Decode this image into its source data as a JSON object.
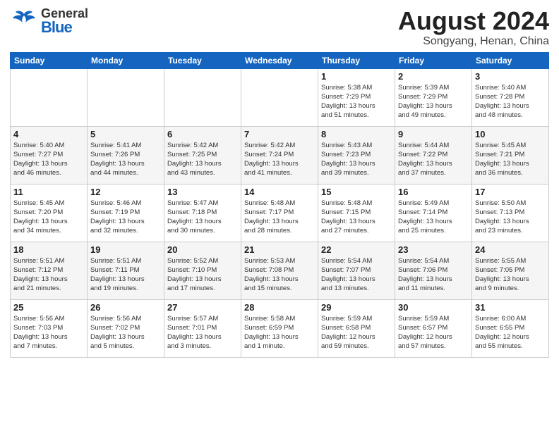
{
  "logo": {
    "general": "General",
    "blue": "Blue"
  },
  "title": "August 2024",
  "location": "Songyang, Henan, China",
  "days_of_week": [
    "Sunday",
    "Monday",
    "Tuesday",
    "Wednesday",
    "Thursday",
    "Friday",
    "Saturday"
  ],
  "weeks": [
    [
      {
        "day": "",
        "info": ""
      },
      {
        "day": "",
        "info": ""
      },
      {
        "day": "",
        "info": ""
      },
      {
        "day": "",
        "info": ""
      },
      {
        "day": "1",
        "info": "Sunrise: 5:38 AM\nSunset: 7:29 PM\nDaylight: 13 hours\nand 51 minutes."
      },
      {
        "day": "2",
        "info": "Sunrise: 5:39 AM\nSunset: 7:29 PM\nDaylight: 13 hours\nand 49 minutes."
      },
      {
        "day": "3",
        "info": "Sunrise: 5:40 AM\nSunset: 7:28 PM\nDaylight: 13 hours\nand 48 minutes."
      }
    ],
    [
      {
        "day": "4",
        "info": "Sunrise: 5:40 AM\nSunset: 7:27 PM\nDaylight: 13 hours\nand 46 minutes."
      },
      {
        "day": "5",
        "info": "Sunrise: 5:41 AM\nSunset: 7:26 PM\nDaylight: 13 hours\nand 44 minutes."
      },
      {
        "day": "6",
        "info": "Sunrise: 5:42 AM\nSunset: 7:25 PM\nDaylight: 13 hours\nand 43 minutes."
      },
      {
        "day": "7",
        "info": "Sunrise: 5:42 AM\nSunset: 7:24 PM\nDaylight: 13 hours\nand 41 minutes."
      },
      {
        "day": "8",
        "info": "Sunrise: 5:43 AM\nSunset: 7:23 PM\nDaylight: 13 hours\nand 39 minutes."
      },
      {
        "day": "9",
        "info": "Sunrise: 5:44 AM\nSunset: 7:22 PM\nDaylight: 13 hours\nand 37 minutes."
      },
      {
        "day": "10",
        "info": "Sunrise: 5:45 AM\nSunset: 7:21 PM\nDaylight: 13 hours\nand 36 minutes."
      }
    ],
    [
      {
        "day": "11",
        "info": "Sunrise: 5:45 AM\nSunset: 7:20 PM\nDaylight: 13 hours\nand 34 minutes."
      },
      {
        "day": "12",
        "info": "Sunrise: 5:46 AM\nSunset: 7:19 PM\nDaylight: 13 hours\nand 32 minutes."
      },
      {
        "day": "13",
        "info": "Sunrise: 5:47 AM\nSunset: 7:18 PM\nDaylight: 13 hours\nand 30 minutes."
      },
      {
        "day": "14",
        "info": "Sunrise: 5:48 AM\nSunset: 7:17 PM\nDaylight: 13 hours\nand 28 minutes."
      },
      {
        "day": "15",
        "info": "Sunrise: 5:48 AM\nSunset: 7:15 PM\nDaylight: 13 hours\nand 27 minutes."
      },
      {
        "day": "16",
        "info": "Sunrise: 5:49 AM\nSunset: 7:14 PM\nDaylight: 13 hours\nand 25 minutes."
      },
      {
        "day": "17",
        "info": "Sunrise: 5:50 AM\nSunset: 7:13 PM\nDaylight: 13 hours\nand 23 minutes."
      }
    ],
    [
      {
        "day": "18",
        "info": "Sunrise: 5:51 AM\nSunset: 7:12 PM\nDaylight: 13 hours\nand 21 minutes."
      },
      {
        "day": "19",
        "info": "Sunrise: 5:51 AM\nSunset: 7:11 PM\nDaylight: 13 hours\nand 19 minutes."
      },
      {
        "day": "20",
        "info": "Sunrise: 5:52 AM\nSunset: 7:10 PM\nDaylight: 13 hours\nand 17 minutes."
      },
      {
        "day": "21",
        "info": "Sunrise: 5:53 AM\nSunset: 7:08 PM\nDaylight: 13 hours\nand 15 minutes."
      },
      {
        "day": "22",
        "info": "Sunrise: 5:54 AM\nSunset: 7:07 PM\nDaylight: 13 hours\nand 13 minutes."
      },
      {
        "day": "23",
        "info": "Sunrise: 5:54 AM\nSunset: 7:06 PM\nDaylight: 13 hours\nand 11 minutes."
      },
      {
        "day": "24",
        "info": "Sunrise: 5:55 AM\nSunset: 7:05 PM\nDaylight: 13 hours\nand 9 minutes."
      }
    ],
    [
      {
        "day": "25",
        "info": "Sunrise: 5:56 AM\nSunset: 7:03 PM\nDaylight: 13 hours\nand 7 minutes."
      },
      {
        "day": "26",
        "info": "Sunrise: 5:56 AM\nSunset: 7:02 PM\nDaylight: 13 hours\nand 5 minutes."
      },
      {
        "day": "27",
        "info": "Sunrise: 5:57 AM\nSunset: 7:01 PM\nDaylight: 13 hours\nand 3 minutes."
      },
      {
        "day": "28",
        "info": "Sunrise: 5:58 AM\nSunset: 6:59 PM\nDaylight: 13 hours\nand 1 minute."
      },
      {
        "day": "29",
        "info": "Sunrise: 5:59 AM\nSunset: 6:58 PM\nDaylight: 12 hours\nand 59 minutes."
      },
      {
        "day": "30",
        "info": "Sunrise: 5:59 AM\nSunset: 6:57 PM\nDaylight: 12 hours\nand 57 minutes."
      },
      {
        "day": "31",
        "info": "Sunrise: 6:00 AM\nSunset: 6:55 PM\nDaylight: 12 hours\nand 55 minutes."
      }
    ]
  ]
}
